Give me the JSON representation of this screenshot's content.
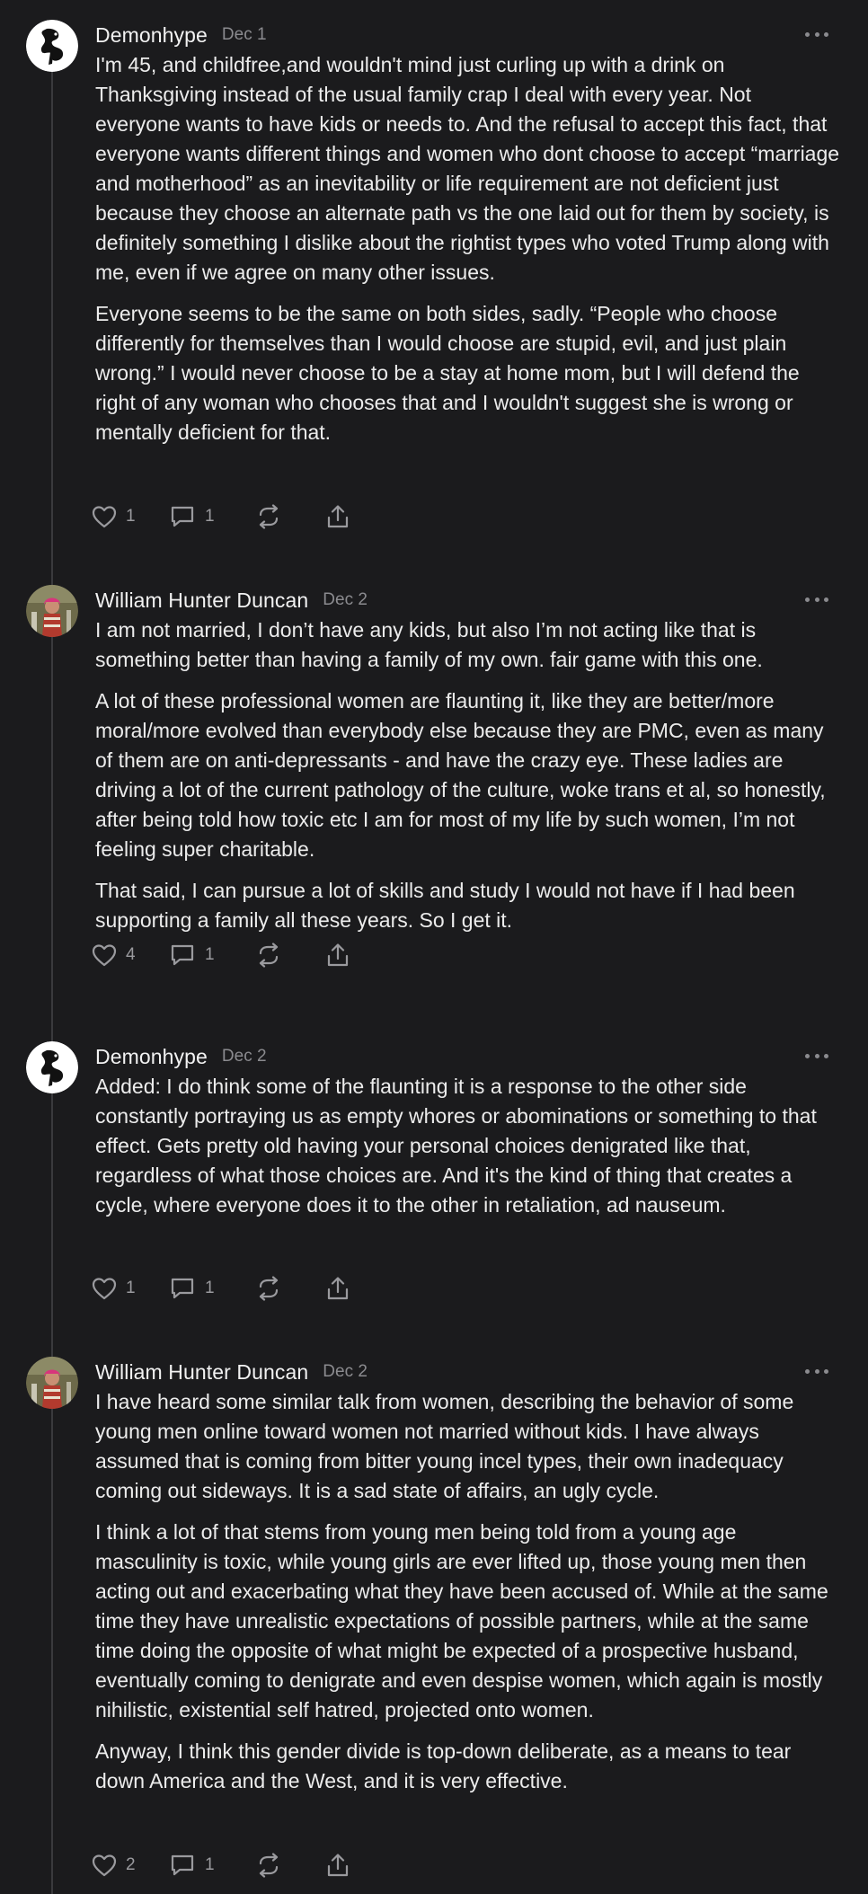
{
  "comments": [
    {
      "author": "Demonhype",
      "date": "Dec 1",
      "avatar": "demonhype-avatar",
      "paragraphs": [
        "I'm 45, and childfree,and wouldn't mind just curling up with a drink on Thanksgiving instead of the usual family crap I deal with every year. Not everyone wants to have kids or needs to. And the refusal to accept this fact, that everyone wants different things and women who dont choose to accept “marriage and motherhood” as an inevitability or life requirement are not deficient just because they choose an alternate path vs the one laid out for them by society, is definitely something I dislike about the rightist types who voted Trump along with me, even if we agree on many other issues.",
        "Everyone seems to be the same on both sides, sadly. “People who choose differently for themselves than I would choose are stupid, evil, and just plain wrong.” I would never choose to be a stay at home mom, but I will defend the right of any woman who chooses that and I wouldn't suggest she is wrong or mentally deficient for that."
      ],
      "likes": "1",
      "replies": "1"
    },
    {
      "author": "William Hunter Duncan",
      "date": "Dec 2",
      "avatar": "william-avatar",
      "paragraphs": [
        "I am not married, I don’t have any kids, but also I’m not acting like that is something better than having a family of my own. fair game with this one.",
        "A lot of these professional women are flaunting it, like they are better/more moral/more evolved than everybody else because they are PMC, even as many of them are on anti-depressants - and have the crazy eye. These ladies are driving a lot of the current pathology of the culture, woke trans et al, so honestly, after being told how toxic etc I am for most of my life by such women, I’m not feeling super charitable.",
        "That said, I can pursue a lot of skills and study I would not have if I had been supporting a family all these years. So I get it."
      ],
      "likes": "4",
      "replies": "1"
    },
    {
      "author": "Demonhype",
      "date": "Dec 2",
      "avatar": "demonhype-avatar",
      "paragraphs": [
        "Added: I do think some of the flaunting it is a response to the other side constantly portraying us as empty whores or abominations or something to that effect. Gets pretty old having your personal choices denigrated like that, regardless of what those choices are. And it's the kind of thing that creates a cycle, where everyone does it to the other in retaliation, ad nauseum."
      ],
      "likes": "1",
      "replies": "1"
    },
    {
      "author": "William Hunter Duncan",
      "date": "Dec 2",
      "avatar": "william-avatar",
      "paragraphs": [
        "I have heard some similar talk from women, describing the behavior of some young men online toward women not married without kids. I have always assumed that is coming from bitter young incel types, their own inadequacy coming out sideways. It is a sad state of affairs, an ugly cycle.",
        "I think a lot of that stems from young men being told from a young age masculinity is toxic, while young girls are ever lifted up, those young men then acting out and exacerbating what they have been accused of. While at the same time they have unrealistic expectations of possible partners, while at the same time doing the opposite of what might be expected of a prospective husband, eventually coming to denigrate and even despise women, which again is mostly nihilistic, existential self hatred, projected onto women.",
        "Anyway, I think this gender divide is top-down deliberate, as a means to tear down America and the West, and it is very effective."
      ],
      "likes": "2",
      "replies": "1"
    }
  ],
  "icons": {
    "like": "heart-icon",
    "reply": "comment-icon",
    "restack": "restack-icon",
    "share": "share-icon",
    "more": "more-horizontal-icon"
  },
  "colors": {
    "background": "#1b1b1d",
    "text": "#ececec",
    "muted": "#8b8b8f",
    "thread_line": "#3a3a3d"
  }
}
